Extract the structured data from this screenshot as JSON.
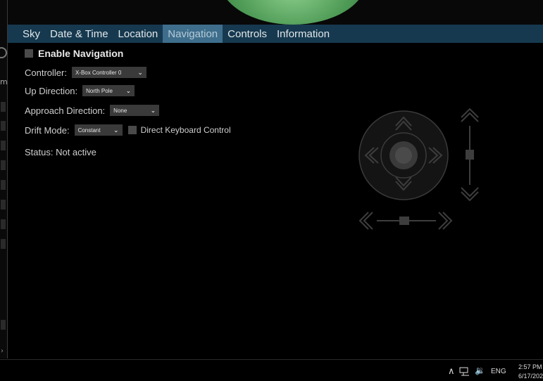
{
  "tabs": [
    "Sky",
    "Date & Time",
    "Location",
    "Navigation",
    "Controls",
    "Information"
  ],
  "active_tab": "Navigation",
  "enable_navigation_label": "Enable Navigation",
  "controller": {
    "label": "Controller:",
    "value": "X-Box Controller 0"
  },
  "up_direction": {
    "label": "Up Direction:",
    "value": "North Pole"
  },
  "approach_direction": {
    "label": "Approach Direction:",
    "value": "None"
  },
  "drift_mode": {
    "label": "Drift Mode:",
    "value": "Constant"
  },
  "direct_keyboard_label": "Direct Keyboard Control",
  "status_text": "Status: Not active",
  "left_strip_letter": "m",
  "taskbar": {
    "language": "ENG",
    "time": "2:57 PM",
    "date": "6/17/202"
  },
  "colors": {
    "tab_bar": "#16394f",
    "active_tab": "#3e6e8c",
    "planet": "#4d9a55"
  },
  "icons": [
    "chevron-up-icon",
    "chevron-down-icon",
    "chevron-left-icon",
    "chevron-right-icon",
    "speaker-icon",
    "network-icon"
  ]
}
